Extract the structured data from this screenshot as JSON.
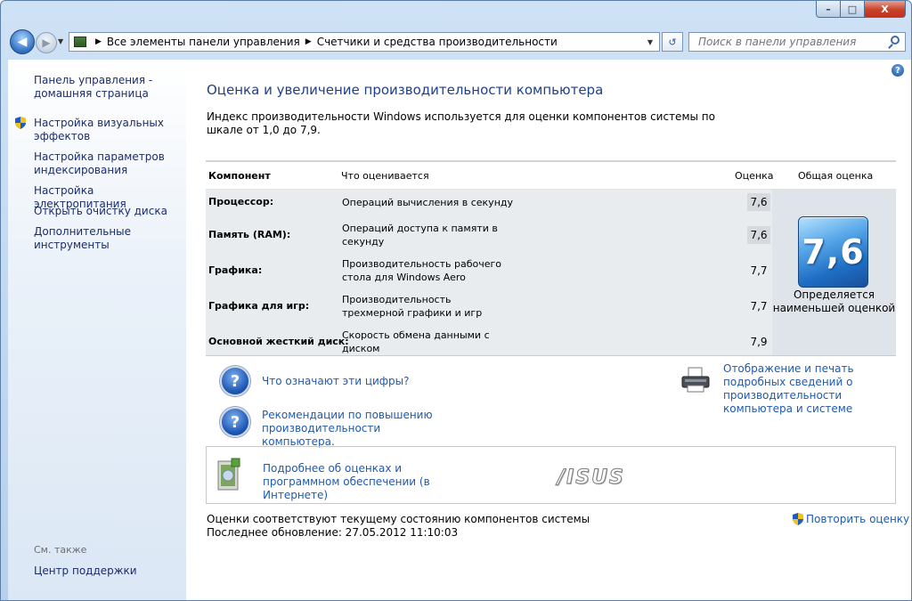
{
  "window": {
    "min_label": "–",
    "max_label": "□",
    "close_label": "X"
  },
  "nav": {
    "address_icon": "control-panel-icon",
    "crumbs": [
      "Все элементы панели управления",
      "Счетчики и средства производительности"
    ],
    "search_placeholder": "Поиск в панели управления"
  },
  "sidebar": {
    "items": [
      {
        "label": "Панель управления - домашняя страница",
        "shield": false
      },
      {
        "label": "Настройка визуальных эффектов",
        "shield": true
      },
      {
        "label": "Настройка параметров индексирования",
        "shield": false
      },
      {
        "label": "Настройка электропитания",
        "shield": false
      },
      {
        "label": "Открыть очистку диска",
        "shield": false
      },
      {
        "label": "Дополнительные инструменты",
        "shield": false
      }
    ],
    "see_also": "См. также",
    "support": "Центр поддержки"
  },
  "main": {
    "title": "Оценка и увеличение производительности компьютера",
    "intro": "Индекс производительности Windows используется для оценки компонентов системы по шкале от 1,0 до 7,9.",
    "table": {
      "headers": {
        "component": "Компонент",
        "what": "Что оценивается",
        "score": "Оценка",
        "total": "Общая оценка"
      },
      "rows": [
        {
          "component": "Процессор:",
          "what": "Операций вычисления в секунду",
          "score": "7,6",
          "highlight": true
        },
        {
          "component": "Память (RAM):",
          "what": "Операций доступа к памяти в секунду",
          "score": "7,6",
          "highlight": true
        },
        {
          "component": "Графика:",
          "what": "Производительность рабочего стола для Windows Aero",
          "score": "7,7",
          "highlight": false
        },
        {
          "component": "Графика для игр:",
          "what": "Производительность трехмерной графики и игр",
          "score": "7,7",
          "highlight": false
        },
        {
          "component": "Основной жесткий диск:",
          "what": "Скорость обмена данными с диском",
          "score": "7,9",
          "highlight": false
        }
      ],
      "total_score": "7,6",
      "total_caption": "Определяется наименьшей оценкой"
    },
    "links": {
      "what_numbers": "Что означают эти цифры?",
      "recommendations": "Рекомендации по повышению производительности компьютера.",
      "print_details": "Отображение и печать подробных сведений о производительности компьютера и системе",
      "more_online": "Подробнее об оценках и программном обеспечении (в Интернете)"
    },
    "oem_logo": "/ISUS",
    "status_line1": "Оценки соответствуют текущему состоянию компонентов системы",
    "status_line2": "Последнее обновление: 27.05.2012 11:10:03",
    "rerun": "Повторить оценку"
  }
}
